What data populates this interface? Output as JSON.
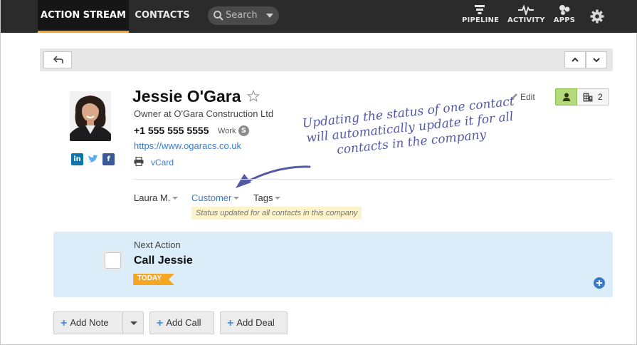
{
  "nav": {
    "tabs": [
      "ACTION STREAM",
      "CONTACTS"
    ],
    "search_placeholder": "Search",
    "icons": [
      {
        "label": "PIPELINE",
        "icon": "pipeline-icon"
      },
      {
        "label": "ACTIVITY",
        "icon": "activity-icon"
      },
      {
        "label": "APPS",
        "icon": "apps-icon"
      }
    ],
    "settings_icon": "gear-icon",
    "accent_color": "#f5a623"
  },
  "contact": {
    "name": "Jessie O'Gara",
    "title": "Owner at O'Gara Construction Ltd",
    "phone": "+1 555 555 5555",
    "phone_type": "Work",
    "website": "https://www.ogaracs.co.uk",
    "vcard_label": "vCard",
    "social": [
      "in",
      "t",
      "f"
    ],
    "edit_label": "Edit",
    "company_count": "2"
  },
  "annotation": "Updating the status of one contact will automatically update it for all contacts in the company",
  "meta": {
    "owner": "Laura M.",
    "status": "Customer",
    "tags": "Tags",
    "status_note": "Status updated for all contacts in this company"
  },
  "next_action": {
    "label": "Next Action",
    "title": "Call Jessie",
    "badge": "TODAY",
    "badge_color": "#f5a623"
  },
  "buttons": {
    "add_note": "Add Note",
    "add_call": "Add Call",
    "add_deal": "Add Deal"
  }
}
